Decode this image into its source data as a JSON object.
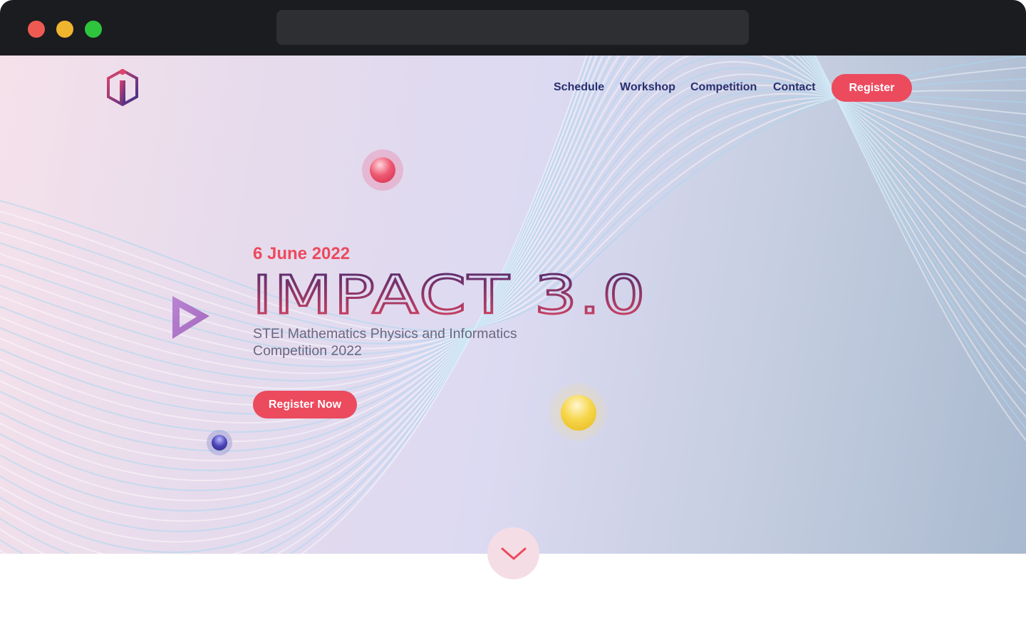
{
  "nav": {
    "links": [
      "Schedule",
      "Workshop",
      "Competition",
      "Contact"
    ],
    "register_label": "Register"
  },
  "hero": {
    "date": "6 June 2022",
    "title": "IMPACT 3.0",
    "subtitle": "STEI Mathematics Physics and Informatics Competition 2022",
    "cta_label": "Register Now"
  },
  "colors": {
    "accent": "#ec4a5d",
    "nav_text": "#2a2e6e",
    "subtitle_text": "#6b6680"
  },
  "icons": {
    "logo": "impact-logo-icon",
    "scroll": "chevron-down-icon",
    "play": "play-triangle-icon"
  }
}
